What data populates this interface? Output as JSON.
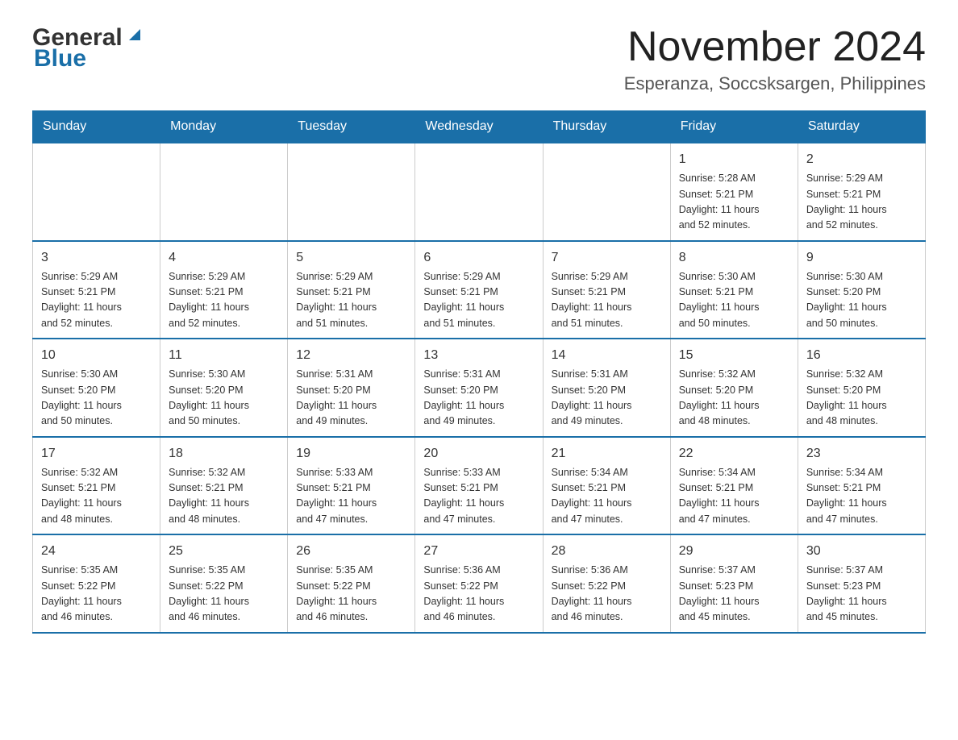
{
  "header": {
    "logo_general": "General",
    "logo_blue": "Blue",
    "month_title": "November 2024",
    "location": "Esperanza, Soccsksargen, Philippines"
  },
  "weekdays": [
    "Sunday",
    "Monday",
    "Tuesday",
    "Wednesday",
    "Thursday",
    "Friday",
    "Saturday"
  ],
  "weeks": [
    [
      {
        "day": "",
        "info": ""
      },
      {
        "day": "",
        "info": ""
      },
      {
        "day": "",
        "info": ""
      },
      {
        "day": "",
        "info": ""
      },
      {
        "day": "",
        "info": ""
      },
      {
        "day": "1",
        "info": "Sunrise: 5:28 AM\nSunset: 5:21 PM\nDaylight: 11 hours\nand 52 minutes."
      },
      {
        "day": "2",
        "info": "Sunrise: 5:29 AM\nSunset: 5:21 PM\nDaylight: 11 hours\nand 52 minutes."
      }
    ],
    [
      {
        "day": "3",
        "info": "Sunrise: 5:29 AM\nSunset: 5:21 PM\nDaylight: 11 hours\nand 52 minutes."
      },
      {
        "day": "4",
        "info": "Sunrise: 5:29 AM\nSunset: 5:21 PM\nDaylight: 11 hours\nand 52 minutes."
      },
      {
        "day": "5",
        "info": "Sunrise: 5:29 AM\nSunset: 5:21 PM\nDaylight: 11 hours\nand 51 minutes."
      },
      {
        "day": "6",
        "info": "Sunrise: 5:29 AM\nSunset: 5:21 PM\nDaylight: 11 hours\nand 51 minutes."
      },
      {
        "day": "7",
        "info": "Sunrise: 5:29 AM\nSunset: 5:21 PM\nDaylight: 11 hours\nand 51 minutes."
      },
      {
        "day": "8",
        "info": "Sunrise: 5:30 AM\nSunset: 5:21 PM\nDaylight: 11 hours\nand 50 minutes."
      },
      {
        "day": "9",
        "info": "Sunrise: 5:30 AM\nSunset: 5:20 PM\nDaylight: 11 hours\nand 50 minutes."
      }
    ],
    [
      {
        "day": "10",
        "info": "Sunrise: 5:30 AM\nSunset: 5:20 PM\nDaylight: 11 hours\nand 50 minutes."
      },
      {
        "day": "11",
        "info": "Sunrise: 5:30 AM\nSunset: 5:20 PM\nDaylight: 11 hours\nand 50 minutes."
      },
      {
        "day": "12",
        "info": "Sunrise: 5:31 AM\nSunset: 5:20 PM\nDaylight: 11 hours\nand 49 minutes."
      },
      {
        "day": "13",
        "info": "Sunrise: 5:31 AM\nSunset: 5:20 PM\nDaylight: 11 hours\nand 49 minutes."
      },
      {
        "day": "14",
        "info": "Sunrise: 5:31 AM\nSunset: 5:20 PM\nDaylight: 11 hours\nand 49 minutes."
      },
      {
        "day": "15",
        "info": "Sunrise: 5:32 AM\nSunset: 5:20 PM\nDaylight: 11 hours\nand 48 minutes."
      },
      {
        "day": "16",
        "info": "Sunrise: 5:32 AM\nSunset: 5:20 PM\nDaylight: 11 hours\nand 48 minutes."
      }
    ],
    [
      {
        "day": "17",
        "info": "Sunrise: 5:32 AM\nSunset: 5:21 PM\nDaylight: 11 hours\nand 48 minutes."
      },
      {
        "day": "18",
        "info": "Sunrise: 5:32 AM\nSunset: 5:21 PM\nDaylight: 11 hours\nand 48 minutes."
      },
      {
        "day": "19",
        "info": "Sunrise: 5:33 AM\nSunset: 5:21 PM\nDaylight: 11 hours\nand 47 minutes."
      },
      {
        "day": "20",
        "info": "Sunrise: 5:33 AM\nSunset: 5:21 PM\nDaylight: 11 hours\nand 47 minutes."
      },
      {
        "day": "21",
        "info": "Sunrise: 5:34 AM\nSunset: 5:21 PM\nDaylight: 11 hours\nand 47 minutes."
      },
      {
        "day": "22",
        "info": "Sunrise: 5:34 AM\nSunset: 5:21 PM\nDaylight: 11 hours\nand 47 minutes."
      },
      {
        "day": "23",
        "info": "Sunrise: 5:34 AM\nSunset: 5:21 PM\nDaylight: 11 hours\nand 47 minutes."
      }
    ],
    [
      {
        "day": "24",
        "info": "Sunrise: 5:35 AM\nSunset: 5:22 PM\nDaylight: 11 hours\nand 46 minutes."
      },
      {
        "day": "25",
        "info": "Sunrise: 5:35 AM\nSunset: 5:22 PM\nDaylight: 11 hours\nand 46 minutes."
      },
      {
        "day": "26",
        "info": "Sunrise: 5:35 AM\nSunset: 5:22 PM\nDaylight: 11 hours\nand 46 minutes."
      },
      {
        "day": "27",
        "info": "Sunrise: 5:36 AM\nSunset: 5:22 PM\nDaylight: 11 hours\nand 46 minutes."
      },
      {
        "day": "28",
        "info": "Sunrise: 5:36 AM\nSunset: 5:22 PM\nDaylight: 11 hours\nand 46 minutes."
      },
      {
        "day": "29",
        "info": "Sunrise: 5:37 AM\nSunset: 5:23 PM\nDaylight: 11 hours\nand 45 minutes."
      },
      {
        "day": "30",
        "info": "Sunrise: 5:37 AM\nSunset: 5:23 PM\nDaylight: 11 hours\nand 45 minutes."
      }
    ]
  ]
}
